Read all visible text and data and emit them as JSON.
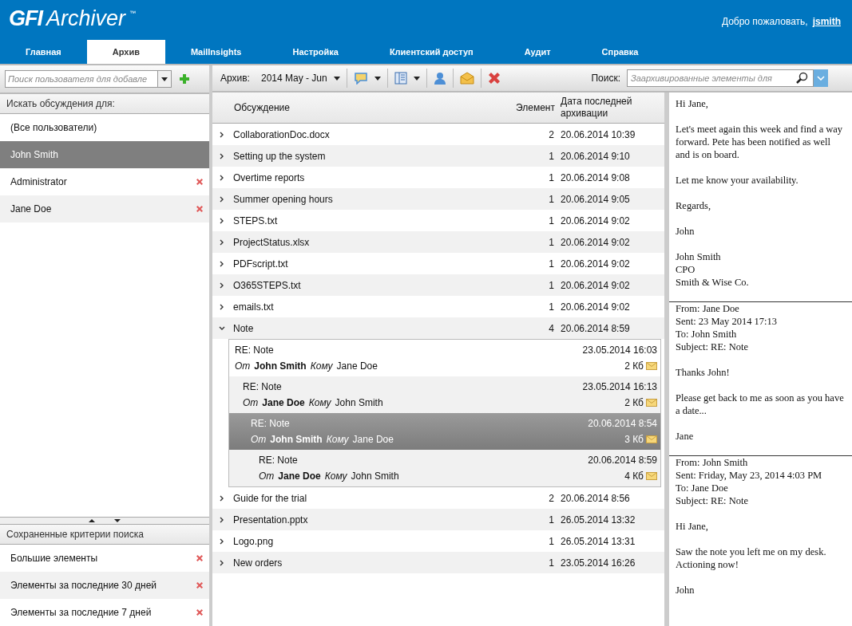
{
  "header": {
    "logo_bold": "GFI",
    "logo_text": "Archiver",
    "trademark": "™",
    "welcome": "Добро пожаловать,",
    "user": "jsmith"
  },
  "tabs": [
    {
      "label": "Главная",
      "selected": false
    },
    {
      "label": "Архив",
      "selected": true
    },
    {
      "label": "MailInsights",
      "selected": false
    },
    {
      "label": "Настройка",
      "selected": false
    },
    {
      "label": "Клиентский доступ",
      "selected": false
    },
    {
      "label": "Аудит",
      "selected": false
    },
    {
      "label": "Справка",
      "selected": false
    }
  ],
  "user_search": {
    "placeholder": "Поиск пользователя для добавле"
  },
  "users_heading": "Искать обсуждения для:",
  "users": [
    {
      "name": "(Все пользователи)",
      "selected": false,
      "removable": false
    },
    {
      "name": "John Smith",
      "selected": true,
      "removable": false
    },
    {
      "name": "Administrator",
      "selected": false,
      "removable": true
    },
    {
      "name": "Jane Doe",
      "selected": false,
      "removable": true
    }
  ],
  "saved_heading": "Сохраненные критерии поиска",
  "saved": [
    {
      "name": "Большие элементы"
    },
    {
      "name": "Элементы за последние 30 дней"
    },
    {
      "name": "Элементы за последние 7 дней"
    }
  ],
  "toolbar": {
    "archive_label": "Архив:",
    "archive_value": "2014 May - Jun",
    "search_label": "Поиск:",
    "search_placeholder": "Заархивированные элементы для"
  },
  "table": {
    "columns": [
      "Обсуждение",
      "Элемент",
      "Дата последней архивации"
    ],
    "rows": [
      {
        "subject": "CollaborationDoc.docx",
        "count": "2",
        "date": "20.06.2014 10:39",
        "expanded": false
      },
      {
        "subject": "Setting up the system",
        "count": "1",
        "date": "20.06.2014 9:10",
        "expanded": false
      },
      {
        "subject": "Overtime reports",
        "count": "1",
        "date": "20.06.2014 9:08",
        "expanded": false
      },
      {
        "subject": "Summer opening hours",
        "count": "1",
        "date": "20.06.2014 9:05",
        "expanded": false
      },
      {
        "subject": "STEPS.txt",
        "count": "1",
        "date": "20.06.2014 9:02",
        "expanded": false
      },
      {
        "subject": "ProjectStatus.xlsx",
        "count": "1",
        "date": "20.06.2014 9:02",
        "expanded": false
      },
      {
        "subject": "PDFscript.txt",
        "count": "1",
        "date": "20.06.2014 9:02",
        "expanded": false
      },
      {
        "subject": "O365STEPS.txt",
        "count": "1",
        "date": "20.06.2014 9:02",
        "expanded": false
      },
      {
        "subject": "emails.txt",
        "count": "1",
        "date": "20.06.2014 9:02",
        "expanded": false
      },
      {
        "subject": "Note",
        "count": "4",
        "date": "20.06.2014 8:59",
        "expanded": true,
        "messages": [
          {
            "subject": "RE: Note",
            "date": "23.05.2014 16:03",
            "from_label": "От",
            "from": "John Smith",
            "to_label": "Кому",
            "to": "Jane Doe",
            "size": "2 Кб",
            "selected": false,
            "children": [
              {
                "subject": "RE: Note",
                "date": "23.05.2014 16:13",
                "from_label": "От",
                "from": "Jane Doe",
                "to_label": "Кому",
                "to": "John Smith",
                "size": "2 Кб",
                "selected": false,
                "children": [
                  {
                    "subject": "RE: Note",
                    "date": "20.06.2014 8:54",
                    "from_label": "От",
                    "from": "John Smith",
                    "to_label": "Кому",
                    "to": "Jane Doe",
                    "size": "3 Кб",
                    "selected": true,
                    "children": [
                      {
                        "subject": "RE: Note",
                        "date": "20.06.2014 8:59",
                        "from_label": "От",
                        "from": "Jane Doe",
                        "to_label": "Кому",
                        "to": "John Smith",
                        "size": "4 Кб",
                        "selected": false
                      }
                    ]
                  }
                ]
              }
            ]
          }
        ]
      },
      {
        "subject": "Guide for the trial",
        "count": "2",
        "date": "20.06.2014 8:56",
        "expanded": false
      },
      {
        "subject": "Presentation.pptx",
        "count": "1",
        "date": "26.05.2014 13:32",
        "expanded": false
      },
      {
        "subject": "Logo.png",
        "count": "1",
        "date": "26.05.2014 13:31",
        "expanded": false
      },
      {
        "subject": "New orders",
        "count": "1",
        "date": "23.05.2014 16:26",
        "expanded": false
      }
    ]
  },
  "reading_pane": [
    {
      "paragraphs": [
        [
          "Hi Jane,"
        ],
        [
          "Let's meet again this week and find a way forward. Pete has been notified as well and is on board."
        ],
        [
          "Let me know your availability."
        ],
        [
          "Regards,"
        ],
        [
          "John"
        ],
        [
          "John Smith",
          "CPO",
          "Smith & Wise Co."
        ]
      ]
    },
    {
      "header": [
        "From: Jane Doe",
        "Sent: 23 May 2014 17:13",
        "To: John Smith",
        "Subject: RE: Note"
      ],
      "paragraphs": [
        [
          "Thanks John!"
        ],
        [
          "Please get back to me as soon as you have a date..."
        ],
        [
          "Jane"
        ]
      ]
    },
    {
      "header": [
        "From: John Smith",
        "Sent: Friday, May 23, 2014 4:03 PM",
        "To: Jane Doe",
        "Subject: RE: Note"
      ],
      "paragraphs": [
        [
          "Hi Jane,"
        ],
        [
          "Saw the note you left me on my desk. Actioning now!"
        ],
        [
          "John"
        ]
      ]
    }
  ]
}
